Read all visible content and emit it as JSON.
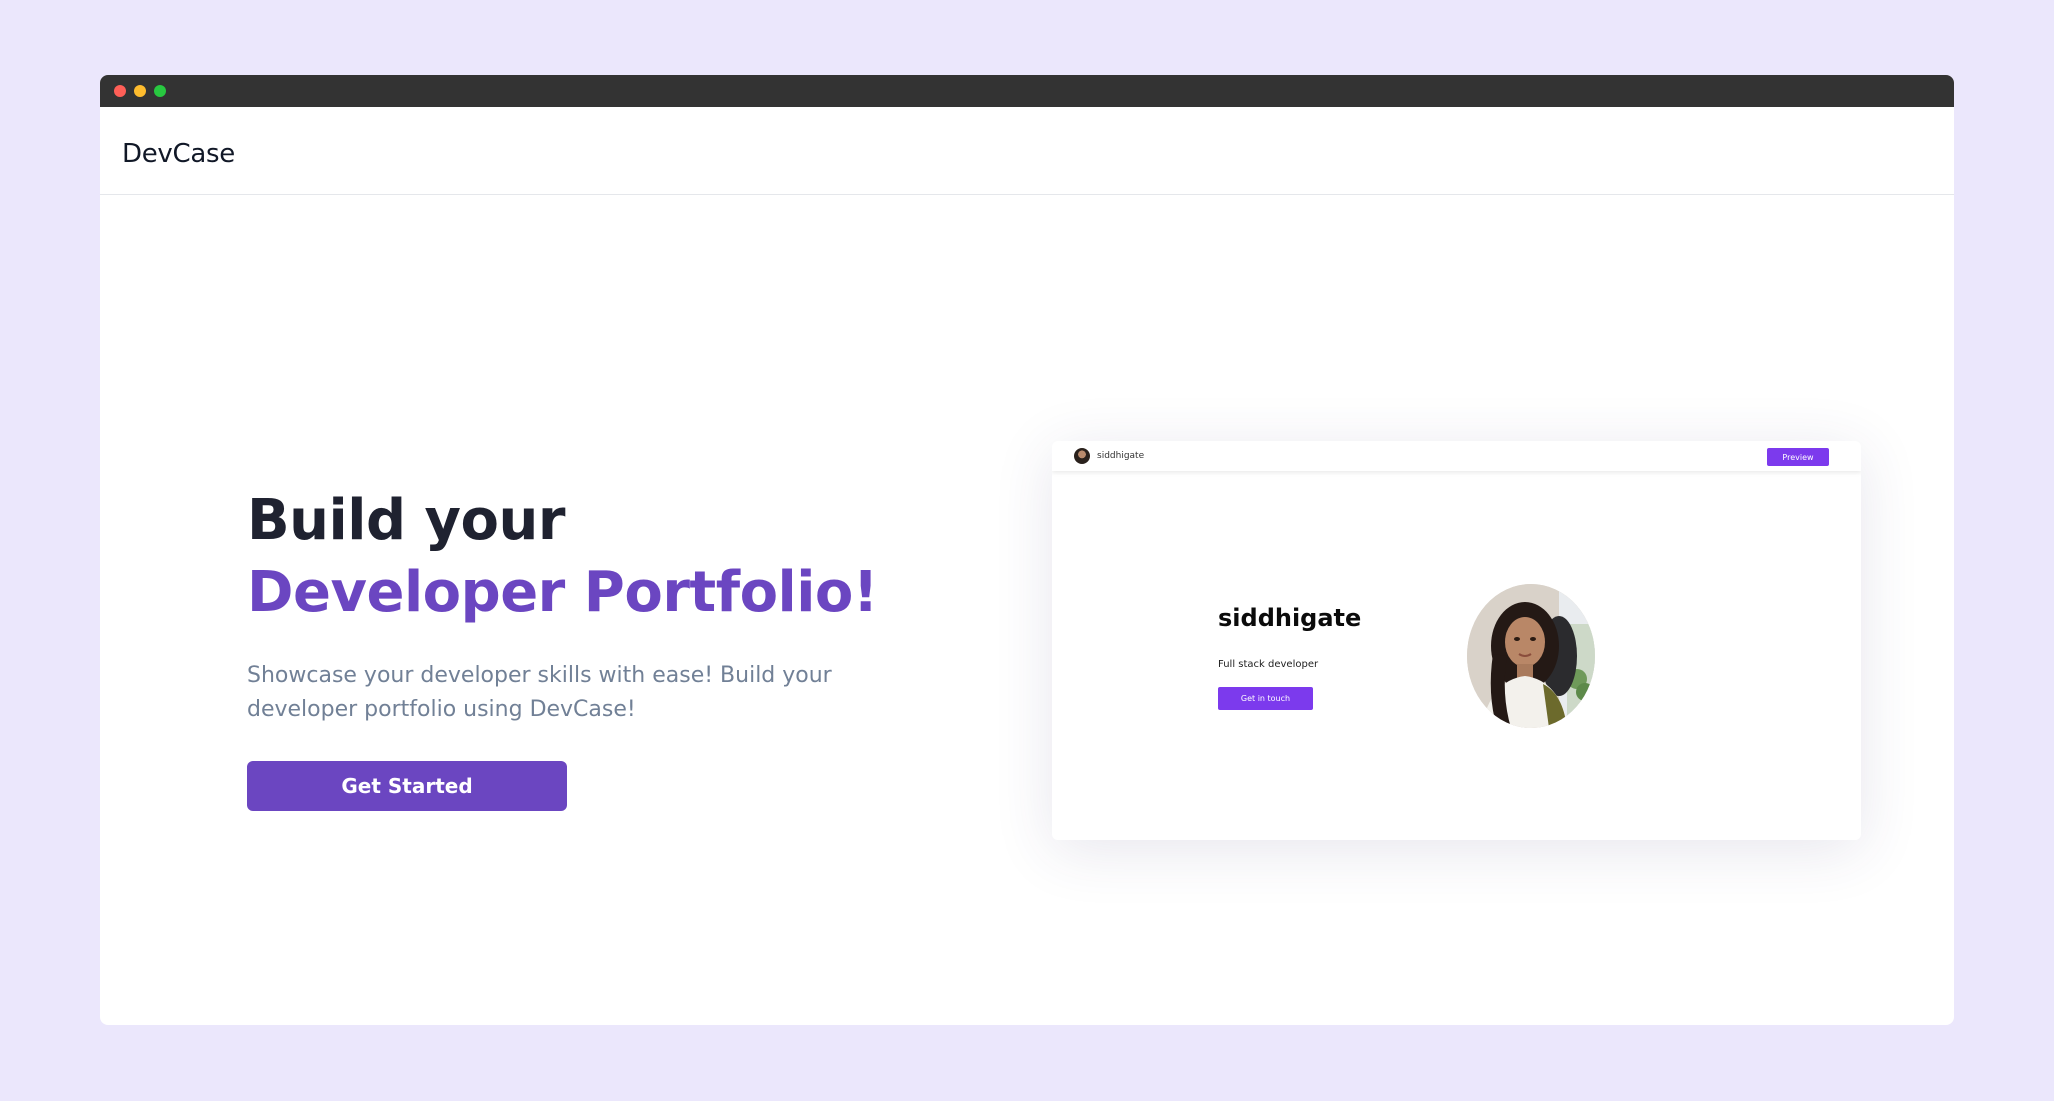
{
  "app": {
    "brand": "DevCase"
  },
  "hero": {
    "title_line1": "Build your",
    "title_line2": "Developer Portfolio!",
    "subtitle": "Showcase your developer skills with ease! Build your developer portfolio using DevCase!",
    "cta_label": "Get Started"
  },
  "preview": {
    "nav_username": "siddhigate",
    "nav_button": "Preview",
    "name": "siddhigate",
    "role": "Full stack developer",
    "contact_button": "Get in touch"
  },
  "colors": {
    "page_background": "#ebe7fc",
    "accent": "#6b46c1",
    "preview_accent": "#7c3aed",
    "titlebar": "#333333"
  }
}
